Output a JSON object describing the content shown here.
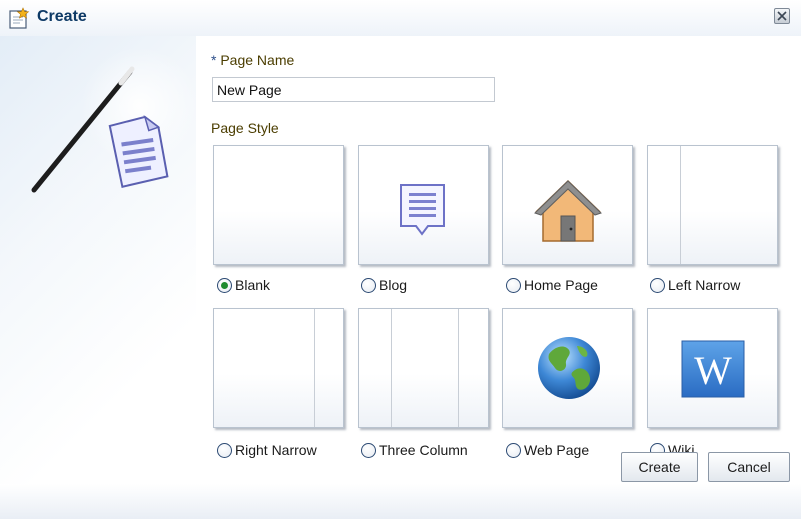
{
  "dialog": {
    "title": "Create",
    "title_icon": "new-page-icon",
    "close_icon": "close-icon"
  },
  "form": {
    "page_name_required_mark": "*",
    "page_name_label": "Page Name",
    "page_name_value": "New Page",
    "page_style_label": "Page Style",
    "selected_style": "Blank"
  },
  "styles": [
    {
      "label": "Blank",
      "icon": "blank-layout",
      "selected": true
    },
    {
      "label": "Blog",
      "icon": "blog-note-icon",
      "selected": false
    },
    {
      "label": "Home Page",
      "icon": "house-icon",
      "selected": false
    },
    {
      "label": "Left Narrow",
      "icon": "left-narrow-layout",
      "selected": false
    },
    {
      "label": "Right Narrow",
      "icon": "right-narrow-layout",
      "selected": false
    },
    {
      "label": "Three Column",
      "icon": "three-column-layout",
      "selected": false
    },
    {
      "label": "Web Page",
      "icon": "globe-icon",
      "selected": false
    },
    {
      "label": "Wiki",
      "icon": "wiki-w-icon",
      "selected": false
    }
  ],
  "buttons": {
    "create": "Create",
    "cancel": "Cancel"
  },
  "colors": {
    "title_text": "#0e3a66",
    "label_text": "#4b3d00",
    "selected_radio": "#1e8a2e"
  }
}
